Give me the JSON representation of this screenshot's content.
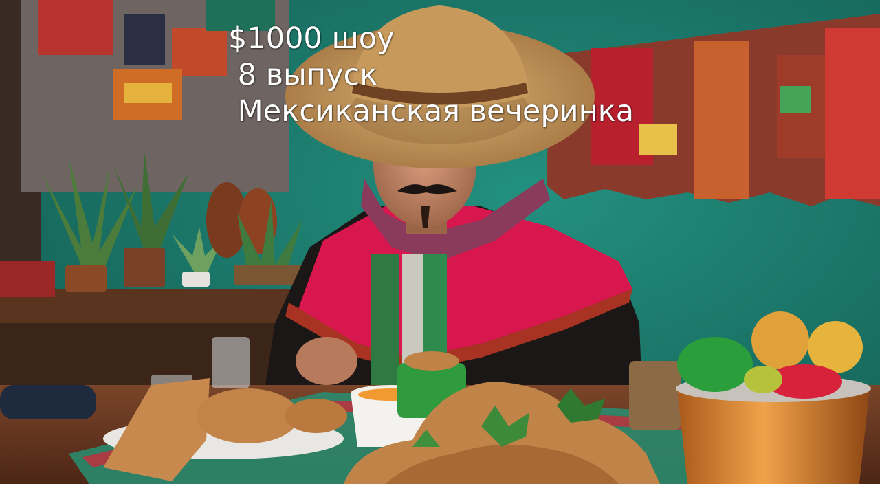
{
  "caption": {
    "line1": "$1000 шоу",
    "line2": " 8 выпуск",
    "line3": " Мексиканская вечеринка"
  },
  "colors": {
    "wall_teal": "#1d7a6c",
    "poncho_red": "#d8174e",
    "caption_text": "#ffffff",
    "table_wood": "#6b3a22"
  },
  "scene": "photo-man-in-sombrero-at-table"
}
